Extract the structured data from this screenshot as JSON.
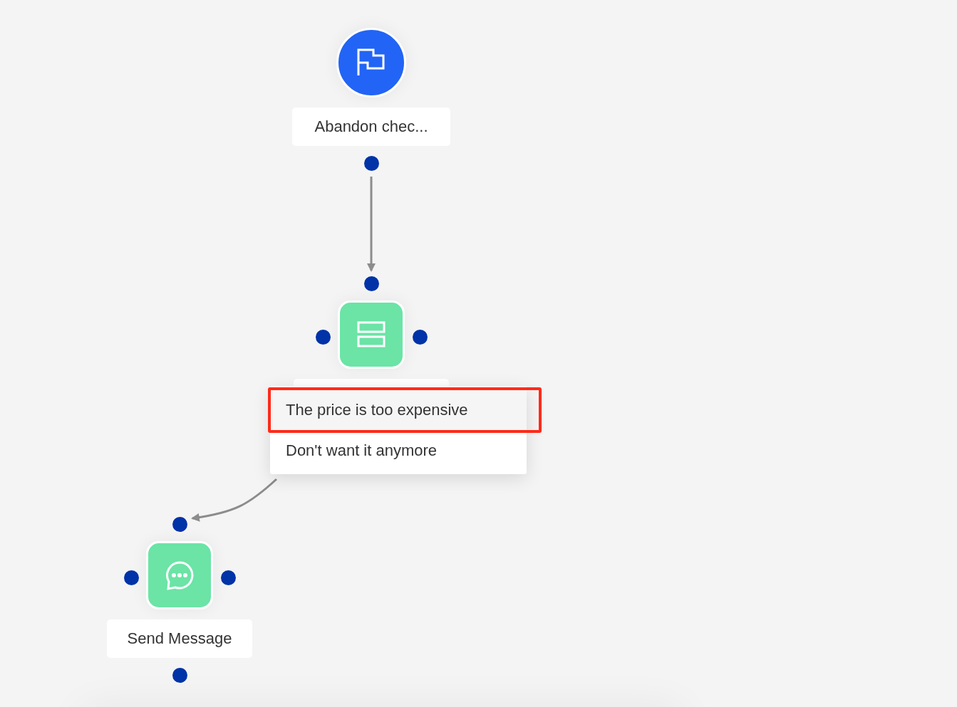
{
  "nodes": [
    {
      "kind": "start",
      "label": "Abandon chec..."
    },
    {
      "kind": "branch",
      "menu": [
        {
          "label": "The price is too expensive",
          "selected": true
        },
        {
          "label": "Don't want it anymore",
          "selected": false
        }
      ]
    },
    {
      "kind": "message",
      "label": "Send Message"
    }
  ]
}
